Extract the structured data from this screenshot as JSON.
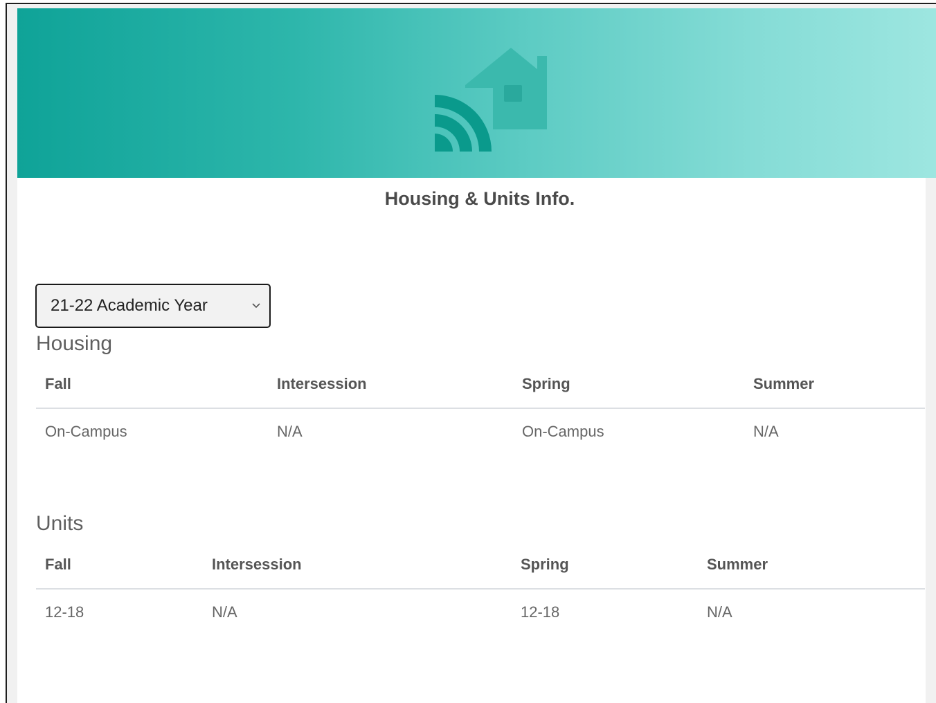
{
  "page": {
    "title": "Housing & Units Info."
  },
  "year_selector": {
    "selected": "21-22 Academic Year"
  },
  "housing": {
    "heading": "Housing",
    "columns": [
      "Fall",
      "Intersession",
      "Spring",
      "Summer"
    ],
    "row": [
      "On-Campus",
      "N/A",
      "On-Campus",
      "N/A"
    ]
  },
  "units": {
    "heading": "Units",
    "columns": [
      "Fall",
      "Intersession",
      "Spring",
      "Summer"
    ],
    "row": [
      "12-18",
      "N/A",
      "12-18",
      "N/A"
    ]
  },
  "colors": {
    "banner_start": "#0fa398",
    "banner_end": "#9de6e0",
    "icon_dark": "#0a9a8c",
    "icon_light": "#3bb9ad"
  },
  "icons": {
    "banner": "home-wifi-icon",
    "select": "chevron-down-icon"
  }
}
